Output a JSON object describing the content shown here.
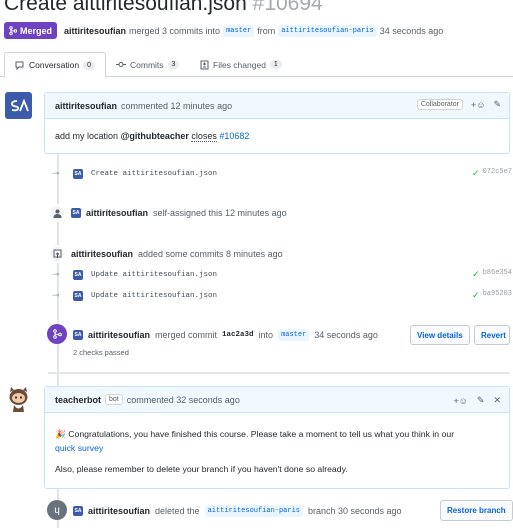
{
  "pr": {
    "title": "Create aittiritesoufian.json",
    "number": "#10694",
    "status_label": "Merged",
    "author": "aittiritesoufian",
    "merge_text": "merged 3 commits into",
    "base_branch": "master",
    "from_text": "from",
    "head_branch": "aittiritesoufian-paris",
    "time": "34 seconds ago"
  },
  "tabs": [
    {
      "label": "Conversation",
      "count": "0"
    },
    {
      "label": "Commits",
      "count": "3"
    },
    {
      "label": "Files changed",
      "count": "1"
    }
  ],
  "first_comment": {
    "author": "aittiritesoufian",
    "action": "commented 12 minutes ago",
    "role": "Collaborator",
    "body_pre": "add my location",
    "mention": "@githubteacher",
    "closes": "closes",
    "issue": "#10682"
  },
  "commit_1": {
    "message": "Create aittiritesoufian.json",
    "sha": "072c5e7"
  },
  "self_assign": {
    "author": "aittiritesoufian",
    "text": "self-assigned this 12 minutes ago"
  },
  "added_commits": {
    "author": "aittiritesoufian",
    "text": "added some commits 8 minutes ago",
    "commits": [
      {
        "message": "Update aittiritesoufian.json",
        "sha": "b86e354"
      },
      {
        "message": "Update aittiritesoufian.json",
        "sha": "ba95203"
      }
    ]
  },
  "merge_event": {
    "author": "aittiritesoufian",
    "text": "merged commit",
    "commit": "1ac2a3d",
    "into": "into",
    "branch": "master",
    "time": "34 seconds ago",
    "checks": "2 checks passed",
    "view_details": "View details",
    "revert": "Revert"
  },
  "bot_comment": {
    "author": "teacherbot",
    "tag": "bot",
    "action": "commented 32 seconds ago",
    "line1": "Congratulations, you have finished this course. Please take a moment to tell us what you think in our",
    "survey_link": "quick survey",
    "line2": "Also, please remember to delete your branch if you haven't done so already."
  },
  "delete_event": {
    "author": "aittiritesoufian",
    "text_pre": "deleted the",
    "branch": "aittiritesoufian-paris",
    "text_post": "branch 30 seconds ago",
    "restore": "Restore branch"
  },
  "colors": {
    "merged": "#6f42c1",
    "link": "#0366d6",
    "success": "#28a745"
  }
}
